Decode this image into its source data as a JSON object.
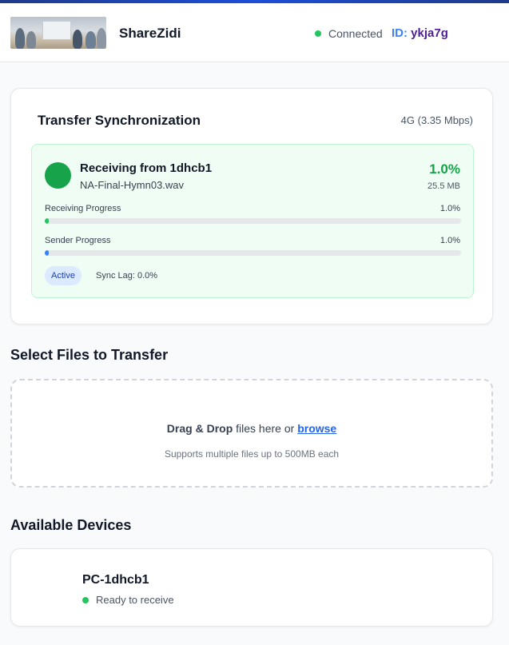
{
  "header": {
    "app_name": "ShareZidi",
    "connection_status": "Connected",
    "id_label": "ID:",
    "id_value": "ykja7g",
    "status_color": "#22c55e"
  },
  "sync": {
    "title": "Transfer Synchronization",
    "network": "4G (3.35 Mbps)",
    "transfer": {
      "from": "Receiving from 1dhcb1",
      "file_name": "NA-Final-Hymn03.wav",
      "percent_text": "1.0%",
      "size": "25.5 MB",
      "receiving_label": "Receiving Progress",
      "receiving_value": "1.0%",
      "receiving_fraction": 0.01,
      "receiving_color": "#22c55e",
      "sender_label": "Sender Progress",
      "sender_value": "1.0%",
      "sender_fraction": 0.01,
      "sender_color": "#3b82f6",
      "badge": "Active",
      "sync_lag": "Sync Lag: 0.0%"
    }
  },
  "files": {
    "title": "Select Files to Transfer",
    "drop_bold": "Drag & Drop",
    "drop_text": " files here or ",
    "browse": "browse",
    "hint": "Supports multiple files up to 500MB each"
  },
  "devices": {
    "title": "Available Devices",
    "items": [
      {
        "name": "PC-1dhcb1",
        "status": "Ready to receive"
      }
    ]
  }
}
